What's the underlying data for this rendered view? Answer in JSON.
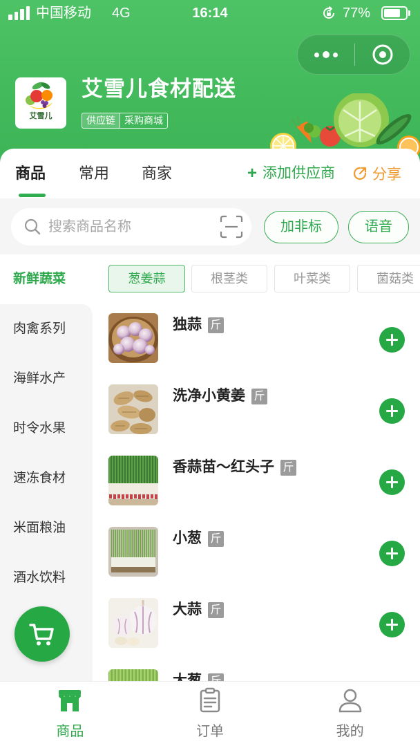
{
  "status_bar": {
    "carrier": "中国移动",
    "network": "4G",
    "time": "16:14",
    "battery": "77%",
    "icons": [
      "signal-icon",
      "rotation-lock-icon",
      "battery-icon"
    ]
  },
  "capsule": {
    "icons": [
      "more-dots-icon",
      "close-target-icon"
    ]
  },
  "store": {
    "logo_text": "艾雪儿",
    "name": "艾雪儿食材配送",
    "tags": [
      "供应链",
      "采购商城"
    ]
  },
  "tabs": [
    {
      "label": "商品",
      "active": true
    },
    {
      "label": "常用",
      "active": false
    },
    {
      "label": "商家",
      "active": false
    }
  ],
  "header_actions": {
    "add_symbol": "+",
    "add_supplier": "添加供应商",
    "share": "分享",
    "share_icon": "share-icon"
  },
  "search": {
    "placeholder": "搜索商品名称",
    "search_icon": "search-icon",
    "scan_icon": "scan-icon",
    "nonstandard_button": "加非标",
    "voice_button": "语音"
  },
  "sidebar": [
    {
      "label": "新鲜蔬菜",
      "active": true
    },
    {
      "label": "肉禽系列",
      "active": false
    },
    {
      "label": "海鲜水产",
      "active": false
    },
    {
      "label": "时令水果",
      "active": false
    },
    {
      "label": "速冻食材",
      "active": false
    },
    {
      "label": "米面粮油",
      "active": false
    },
    {
      "label": "酒水饮料",
      "active": false
    }
  ],
  "subcategories": [
    {
      "label": "葱姜蒜",
      "active": true
    },
    {
      "label": "根茎类",
      "active": false
    },
    {
      "label": "叶菜类",
      "active": false
    },
    {
      "label": "菌菇类",
      "active": false
    }
  ],
  "products": [
    {
      "name": "独蒜",
      "unit": "斤"
    },
    {
      "name": "洗净小黄姜",
      "unit": "斤"
    },
    {
      "name": "香蒜苗～红头子",
      "unit": "斤"
    },
    {
      "name": "小葱",
      "unit": "斤"
    },
    {
      "name": "大蒜",
      "unit": "斤"
    },
    {
      "name": "大葱",
      "unit": "斤"
    }
  ],
  "cart_button": {
    "icon": "cart-icon"
  },
  "bottom_nav": [
    {
      "label": "商品",
      "icon": "store-icon",
      "active": true
    },
    {
      "label": "订单",
      "icon": "clipboard-icon",
      "active": false
    },
    {
      "label": "我的",
      "icon": "user-icon",
      "active": false
    }
  ],
  "colors": {
    "brand": "#2fae4e",
    "header": "#43ba5c",
    "share": "#f09a30",
    "inactive": "#777777"
  }
}
